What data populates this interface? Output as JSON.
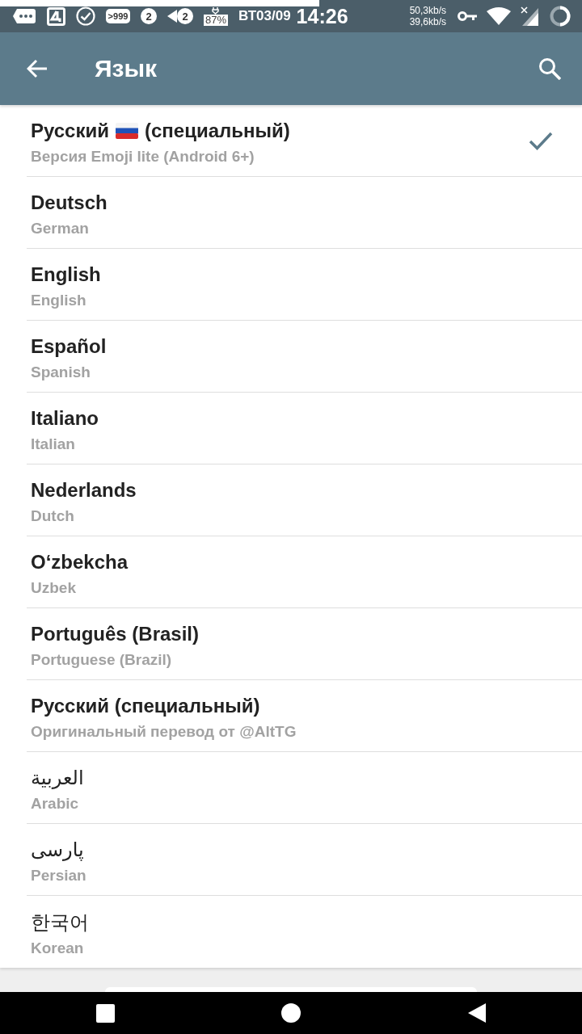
{
  "status_bar": {
    "notification_count": ">999",
    "badges": [
      "2",
      "2"
    ],
    "battery": "87%",
    "date": "ВТ03/09",
    "time": "14:26",
    "upload_speed": "50,3kb/s",
    "download_speed": "39,6kb/s"
  },
  "app_bar": {
    "title": "Язык"
  },
  "languages": [
    {
      "kind": "flag",
      "title": "Русский",
      "title_suffix": "(специальный)",
      "subtitle": "Версия Emoji lite (Android 6+)",
      "selected": true
    },
    {
      "kind": "plain",
      "title": "Deutsch",
      "subtitle": "German",
      "selected": false
    },
    {
      "kind": "plain",
      "title": "English",
      "subtitle": "English",
      "selected": false
    },
    {
      "kind": "plain",
      "title": "Español",
      "subtitle": "Spanish",
      "selected": false
    },
    {
      "kind": "plain",
      "title": "Italiano",
      "subtitle": "Italian",
      "selected": false
    },
    {
      "kind": "plain",
      "title": "Nederlands",
      "subtitle": "Dutch",
      "selected": false
    },
    {
      "kind": "plain",
      "title": "O‘zbekcha",
      "subtitle": "Uzbek",
      "selected": false
    },
    {
      "kind": "plain",
      "title": "Português (Brasil)",
      "subtitle": "Portuguese (Brazil)",
      "selected": false
    },
    {
      "kind": "plain",
      "title": "Русский (специальный)",
      "subtitle": "Оригинальный перевод от @AltTG",
      "selected": false
    },
    {
      "kind": "regular",
      "title": "العربية",
      "subtitle": "Arabic",
      "selected": false
    },
    {
      "kind": "regular",
      "title": "پارسی",
      "subtitle": "Persian",
      "selected": false
    },
    {
      "kind": "regular",
      "title": "한국어",
      "subtitle": "Korean",
      "selected": false
    }
  ]
}
